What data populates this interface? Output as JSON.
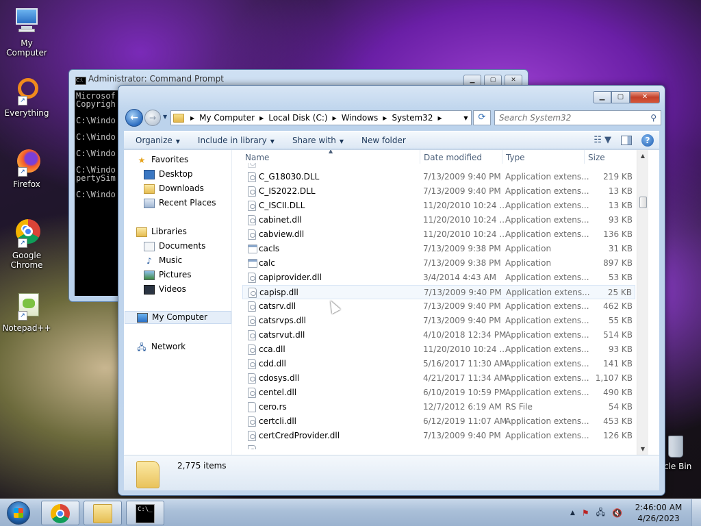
{
  "desktop": {
    "icons": [
      {
        "label": "My Computer"
      },
      {
        "label": "Everything"
      },
      {
        "label": "Firefox"
      },
      {
        "label": "Google Chrome"
      },
      {
        "label": "Notepad++"
      },
      {
        "label": "cle Bin"
      }
    ]
  },
  "cmd_window": {
    "title": "Administrator: Command Prompt",
    "lines": [
      "Microsof",
      "Copyrigh",
      "",
      "C:\\Windo",
      "",
      "C:\\Windo",
      "",
      "C:\\Windo",
      "",
      "C:\\Windo",
      "pertySim",
      "",
      "C:\\Windo"
    ]
  },
  "explorer": {
    "breadcrumb": [
      "My Computer",
      "Local Disk (C:)",
      "Windows",
      "System32"
    ],
    "search_placeholder": "Search System32",
    "toolbar": {
      "organize": "Organize",
      "include_in_library": "Include in library",
      "share_with": "Share with",
      "new_folder": "New folder"
    },
    "nav": {
      "favorites": "Favorites",
      "desktop": "Desktop",
      "downloads": "Downloads",
      "recent_places": "Recent Places",
      "libraries": "Libraries",
      "documents": "Documents",
      "music": "Music",
      "pictures": "Pictures",
      "videos": "Videos",
      "my_computer": "My Computer",
      "network": "Network"
    },
    "columns": {
      "name": "Name",
      "date": "Date modified",
      "type": "Type",
      "size": "Size"
    },
    "files": [
      {
        "name": "C_G18030.DLL",
        "date": "7/13/2009 9:40 PM",
        "type": "Application extens...",
        "size": "219 KB",
        "icon": "dll"
      },
      {
        "name": "C_IS2022.DLL",
        "date": "7/13/2009 9:40 PM",
        "type": "Application extens...",
        "size": "13 KB",
        "icon": "dll"
      },
      {
        "name": "C_ISCII.DLL",
        "date": "11/20/2010 10:24 ...",
        "type": "Application extens...",
        "size": "13 KB",
        "icon": "dll"
      },
      {
        "name": "cabinet.dll",
        "date": "11/20/2010 10:24 ...",
        "type": "Application extens...",
        "size": "93 KB",
        "icon": "dll"
      },
      {
        "name": "cabview.dll",
        "date": "11/20/2010 10:24 ...",
        "type": "Application extens...",
        "size": "136 KB",
        "icon": "dll"
      },
      {
        "name": "cacls",
        "date": "7/13/2009 9:38 PM",
        "type": "Application",
        "size": "31 KB",
        "icon": "app"
      },
      {
        "name": "calc",
        "date": "7/13/2009 9:38 PM",
        "type": "Application",
        "size": "897 KB",
        "icon": "app"
      },
      {
        "name": "capiprovider.dll",
        "date": "3/4/2014 4:43 AM",
        "type": "Application extens...",
        "size": "53 KB",
        "icon": "dll"
      },
      {
        "name": "capisp.dll",
        "date": "7/13/2009 9:40 PM",
        "type": "Application extens...",
        "size": "25 KB",
        "icon": "dll",
        "selected": true
      },
      {
        "name": "catsrv.dll",
        "date": "7/13/2009 9:40 PM",
        "type": "Application extens...",
        "size": "462 KB",
        "icon": "dll"
      },
      {
        "name": "catsrvps.dll",
        "date": "7/13/2009 9:40 PM",
        "type": "Application extens...",
        "size": "55 KB",
        "icon": "dll"
      },
      {
        "name": "catsrvut.dll",
        "date": "4/10/2018 12:34 PM",
        "type": "Application extens...",
        "size": "514 KB",
        "icon": "dll"
      },
      {
        "name": "cca.dll",
        "date": "11/20/2010 10:24 ...",
        "type": "Application extens...",
        "size": "93 KB",
        "icon": "dll"
      },
      {
        "name": "cdd.dll",
        "date": "5/16/2017 11:30 AM",
        "type": "Application extens...",
        "size": "141 KB",
        "icon": "dll"
      },
      {
        "name": "cdosys.dll",
        "date": "4/21/2017 11:34 AM",
        "type": "Application extens...",
        "size": "1,107 KB",
        "icon": "dll"
      },
      {
        "name": "centel.dll",
        "date": "6/10/2019 10:59 PM",
        "type": "Application extens...",
        "size": "490 KB",
        "icon": "dll"
      },
      {
        "name": "cero.rs",
        "date": "12/7/2012 6:19 AM",
        "type": "RS File",
        "size": "54 KB",
        "icon": "rs"
      },
      {
        "name": "certcli.dll",
        "date": "6/12/2019 11:07 AM",
        "type": "Application extens...",
        "size": "453 KB",
        "icon": "dll"
      },
      {
        "name": "certCredProvider.dll",
        "date": "7/13/2009 9:40 PM",
        "type": "Application extens...",
        "size": "126 KB",
        "icon": "dll"
      }
    ],
    "status": {
      "item_count": "2,775 items"
    }
  },
  "taskbar": {
    "clock_time": "2:46:00 AM",
    "clock_date": "4/26/2023"
  }
}
